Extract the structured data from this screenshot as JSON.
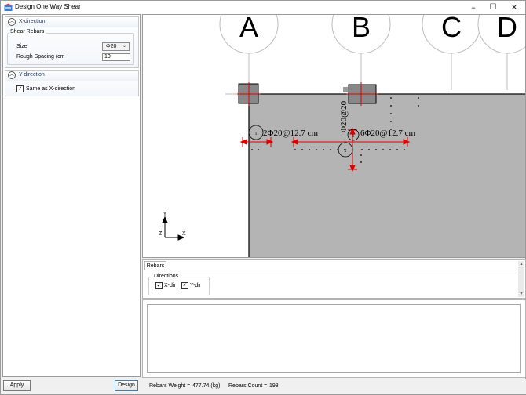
{
  "window": {
    "title": "Design One Way Shear"
  },
  "left_panel": {
    "x_direction": {
      "header": "X-direction",
      "group_label": "Shear Rebars",
      "size_label": "Size",
      "size_value": "Φ20",
      "spacing_label": "Rough Spacing (cm",
      "spacing_value": "10"
    },
    "y_direction": {
      "header": "Y-direction",
      "same_as_label": "Same as X-direction",
      "same_as_checked": true
    }
  },
  "buttons": {
    "apply": "Apply",
    "design": "Design"
  },
  "drawing": {
    "grid_labels": [
      "A",
      "B",
      "C",
      "D"
    ],
    "annotations": {
      "left_rebar": "2Φ20@12.7 cm",
      "right_rebar": "6Φ20@12.7 cm",
      "vertical_rebar": "Φ20@20",
      "marker_1": "1",
      "marker_2": "2",
      "marker_3": "1"
    },
    "axis": {
      "x": "X",
      "y": "Y",
      "z": "Z"
    }
  },
  "rebars_tab": {
    "tab_label": "Rebars",
    "directions_label": "Directions",
    "x_dir_label": "X-dir",
    "y_dir_label": "Y-dir",
    "x_dir_checked": true,
    "y_dir_checked": true
  },
  "status": {
    "weight_label": "Rebars Weight =",
    "weight_value": "477.74 (kg)",
    "count_label": "Rebars Count =",
    "count_value": "198"
  },
  "colors": {
    "slab": "#b4b4b4",
    "column": "#888888",
    "dimension": "#e00000",
    "accent_border": "#3c7fb1"
  }
}
